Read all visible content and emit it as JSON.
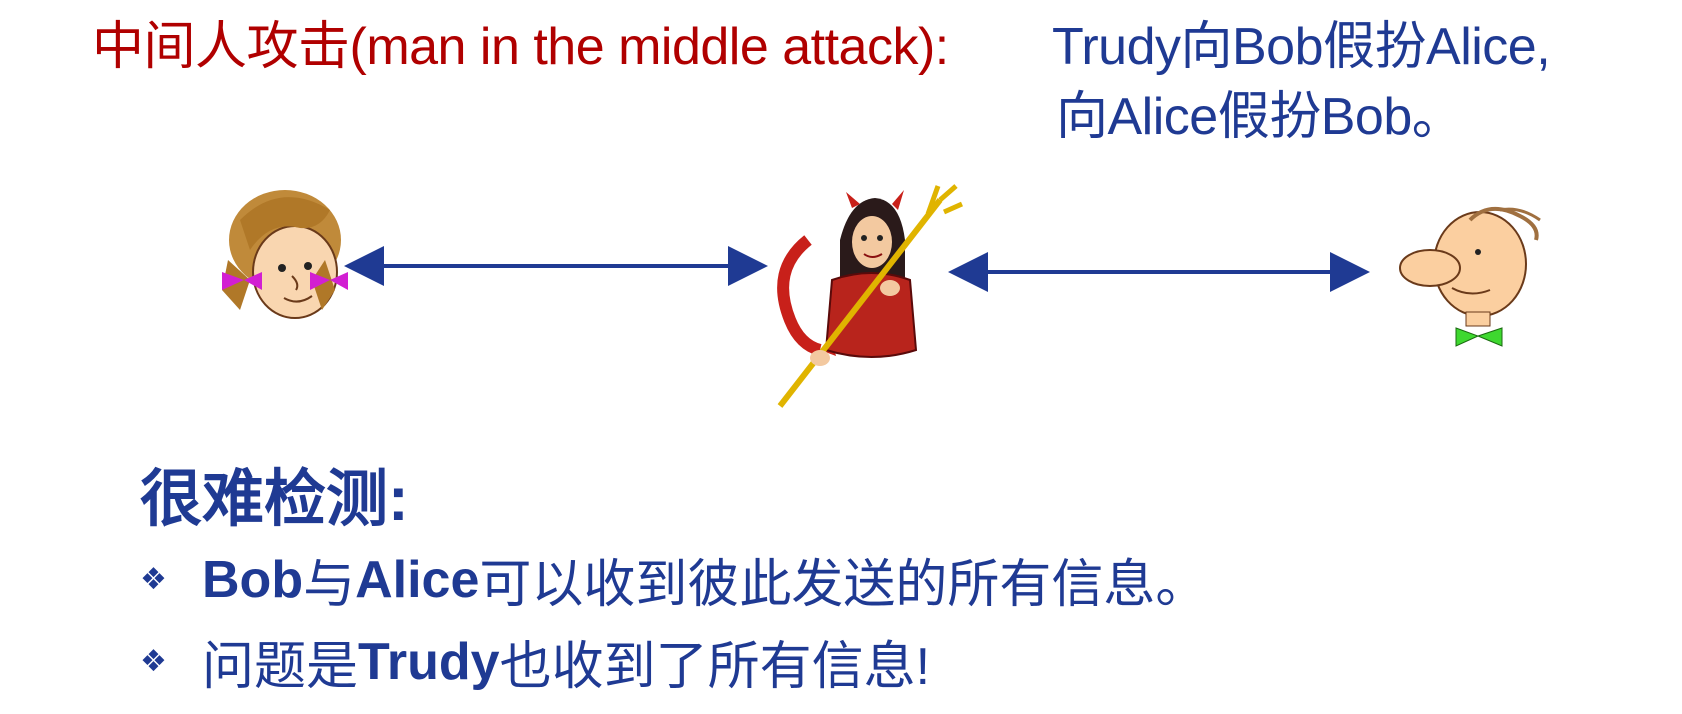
{
  "title": {
    "red": "中间人攻击(man in the middle attack):",
    "blue_line1": "Trudy向Bob假扮Alice,",
    "blue_line2": "向Alice假扮Bob。"
  },
  "diagram": {
    "arrow_color": "#1f3a93"
  },
  "heading": "很难检测:",
  "bullets": {
    "mark": "❖",
    "b1_bold1": "Bob",
    "b1_text1": "与",
    "b1_bold2": "Alice",
    "b1_text2": "可以收到彼此发送的所有信息。",
    "b2_text1": "问题是",
    "b2_bold1": "Trudy",
    "b2_text2": "也收到了所有信息!"
  },
  "colors": {
    "title_red": "#b00000",
    "blue": "#1f3a93"
  }
}
